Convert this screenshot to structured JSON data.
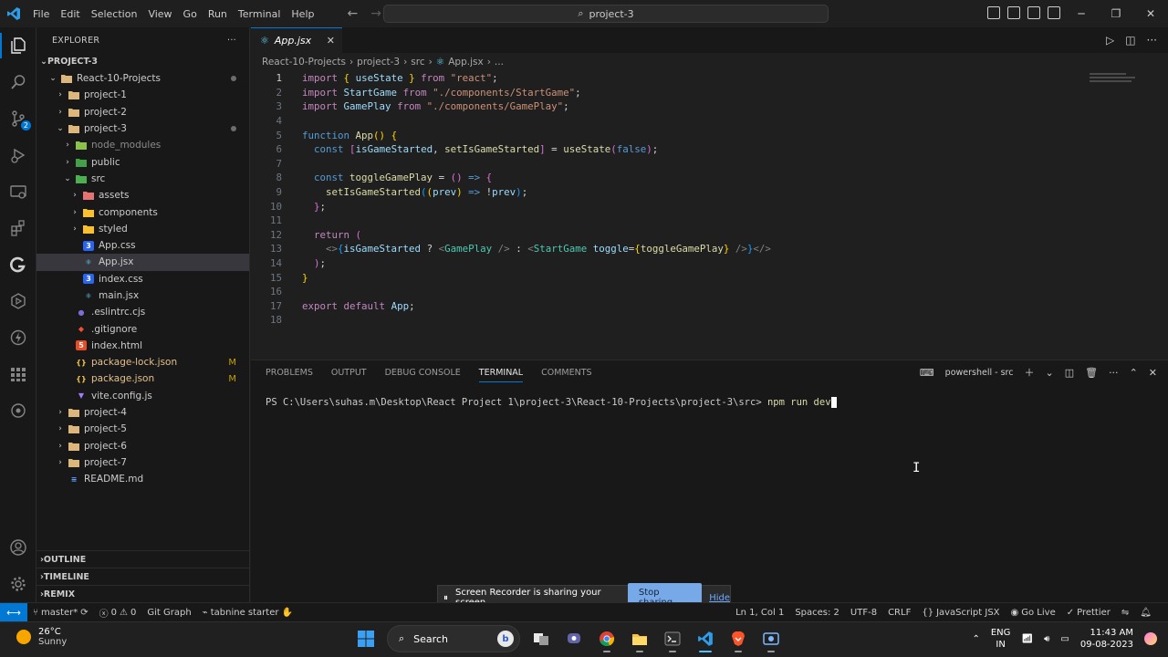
{
  "titlebar": {
    "menu": [
      "File",
      "Edit",
      "Selection",
      "View",
      "Go",
      "Run",
      "Terminal",
      "Help"
    ],
    "search": "project-3"
  },
  "activity_badges": {
    "source_control": "2"
  },
  "explorer": {
    "title": "EXPLORER",
    "more": "···",
    "root": "PROJECT-3",
    "items": [
      {
        "label": "React-10-Projects",
        "depth": 1,
        "kind": "folder-open"
      },
      {
        "label": "project-1",
        "depth": 2,
        "kind": "folder"
      },
      {
        "label": "project-2",
        "depth": 2,
        "kind": "folder"
      },
      {
        "label": "project-3",
        "depth": 2,
        "kind": "folder-open"
      },
      {
        "label": "node_modules",
        "depth": 3,
        "kind": "folder"
      },
      {
        "label": "public",
        "depth": 3,
        "kind": "folder"
      },
      {
        "label": "src",
        "depth": 3,
        "kind": "folder-open"
      },
      {
        "label": "assets",
        "depth": 4,
        "kind": "folder"
      },
      {
        "label": "components",
        "depth": 4,
        "kind": "folder"
      },
      {
        "label": "styled",
        "depth": 4,
        "kind": "folder"
      },
      {
        "label": "App.css",
        "depth": 4,
        "kind": "css"
      },
      {
        "label": "App.jsx",
        "depth": 4,
        "kind": "jsx"
      },
      {
        "label": "index.css",
        "depth": 4,
        "kind": "css"
      },
      {
        "label": "main.jsx",
        "depth": 4,
        "kind": "jsx"
      },
      {
        "label": ".eslintrc.cjs",
        "depth": 3,
        "kind": "eslint"
      },
      {
        "label": ".gitignore",
        "depth": 3,
        "kind": "git"
      },
      {
        "label": "index.html",
        "depth": 3,
        "kind": "html"
      },
      {
        "label": "package-lock.json",
        "depth": 3,
        "kind": "json",
        "badge": "M"
      },
      {
        "label": "package.json",
        "depth": 3,
        "kind": "json",
        "badge": "M"
      },
      {
        "label": "vite.config.js",
        "depth": 3,
        "kind": "vite"
      },
      {
        "label": "project-4",
        "depth": 2,
        "kind": "folder"
      },
      {
        "label": "project-5",
        "depth": 2,
        "kind": "folder"
      },
      {
        "label": "project-6",
        "depth": 2,
        "kind": "folder"
      },
      {
        "label": "project-7",
        "depth": 2,
        "kind": "folder"
      },
      {
        "label": "README.md",
        "depth": 2,
        "kind": "md"
      }
    ],
    "outline": "OUTLINE",
    "timeline": "TIMELINE",
    "remix": "REMIX"
  },
  "editor": {
    "tab": "App.jsx",
    "breadcrumb": [
      "React-10-Projects",
      "project-3",
      "src",
      "App.jsx",
      "..."
    ],
    "line_numbers": [
      "1",
      "2",
      "3",
      "4",
      "5",
      "6",
      "7",
      "8",
      "9",
      "10",
      "11",
      "12",
      "13",
      "14",
      "15",
      "16",
      "17",
      "18"
    ]
  },
  "panel": {
    "tabs": [
      "PROBLEMS",
      "OUTPUT",
      "DEBUG CONSOLE",
      "TERMINAL",
      "COMMENTS"
    ],
    "active_tab": "TERMINAL",
    "shell": "powershell - src",
    "prompt": "PS C:\\Users\\suhas.m\\Desktop\\React Project 1\\project-3\\React-10-Projects\\project-3\\src>",
    "command": "npm run dev"
  },
  "recorder": {
    "message": "Screen Recorder is sharing your screen.",
    "stop": "Stop sharing",
    "hide": "Hide"
  },
  "statusbar": {
    "branch": "master*",
    "errors": "0",
    "warnings": "0",
    "git_graph": "Git Graph",
    "tabnine": "tabnine starter",
    "position": "Ln 1, Col 1",
    "spaces": "Spaces: 2",
    "encoding": "UTF-8",
    "eol": "CRLF",
    "language": "JavaScript JSX",
    "golive": "Go Live",
    "prettier": "Prettier"
  },
  "taskbar": {
    "temp": "26°C",
    "weather": "Sunny",
    "search": "Search",
    "lang1": "ENG",
    "lang2": "IN",
    "time": "11:43 AM",
    "date": "09-08-2023"
  }
}
